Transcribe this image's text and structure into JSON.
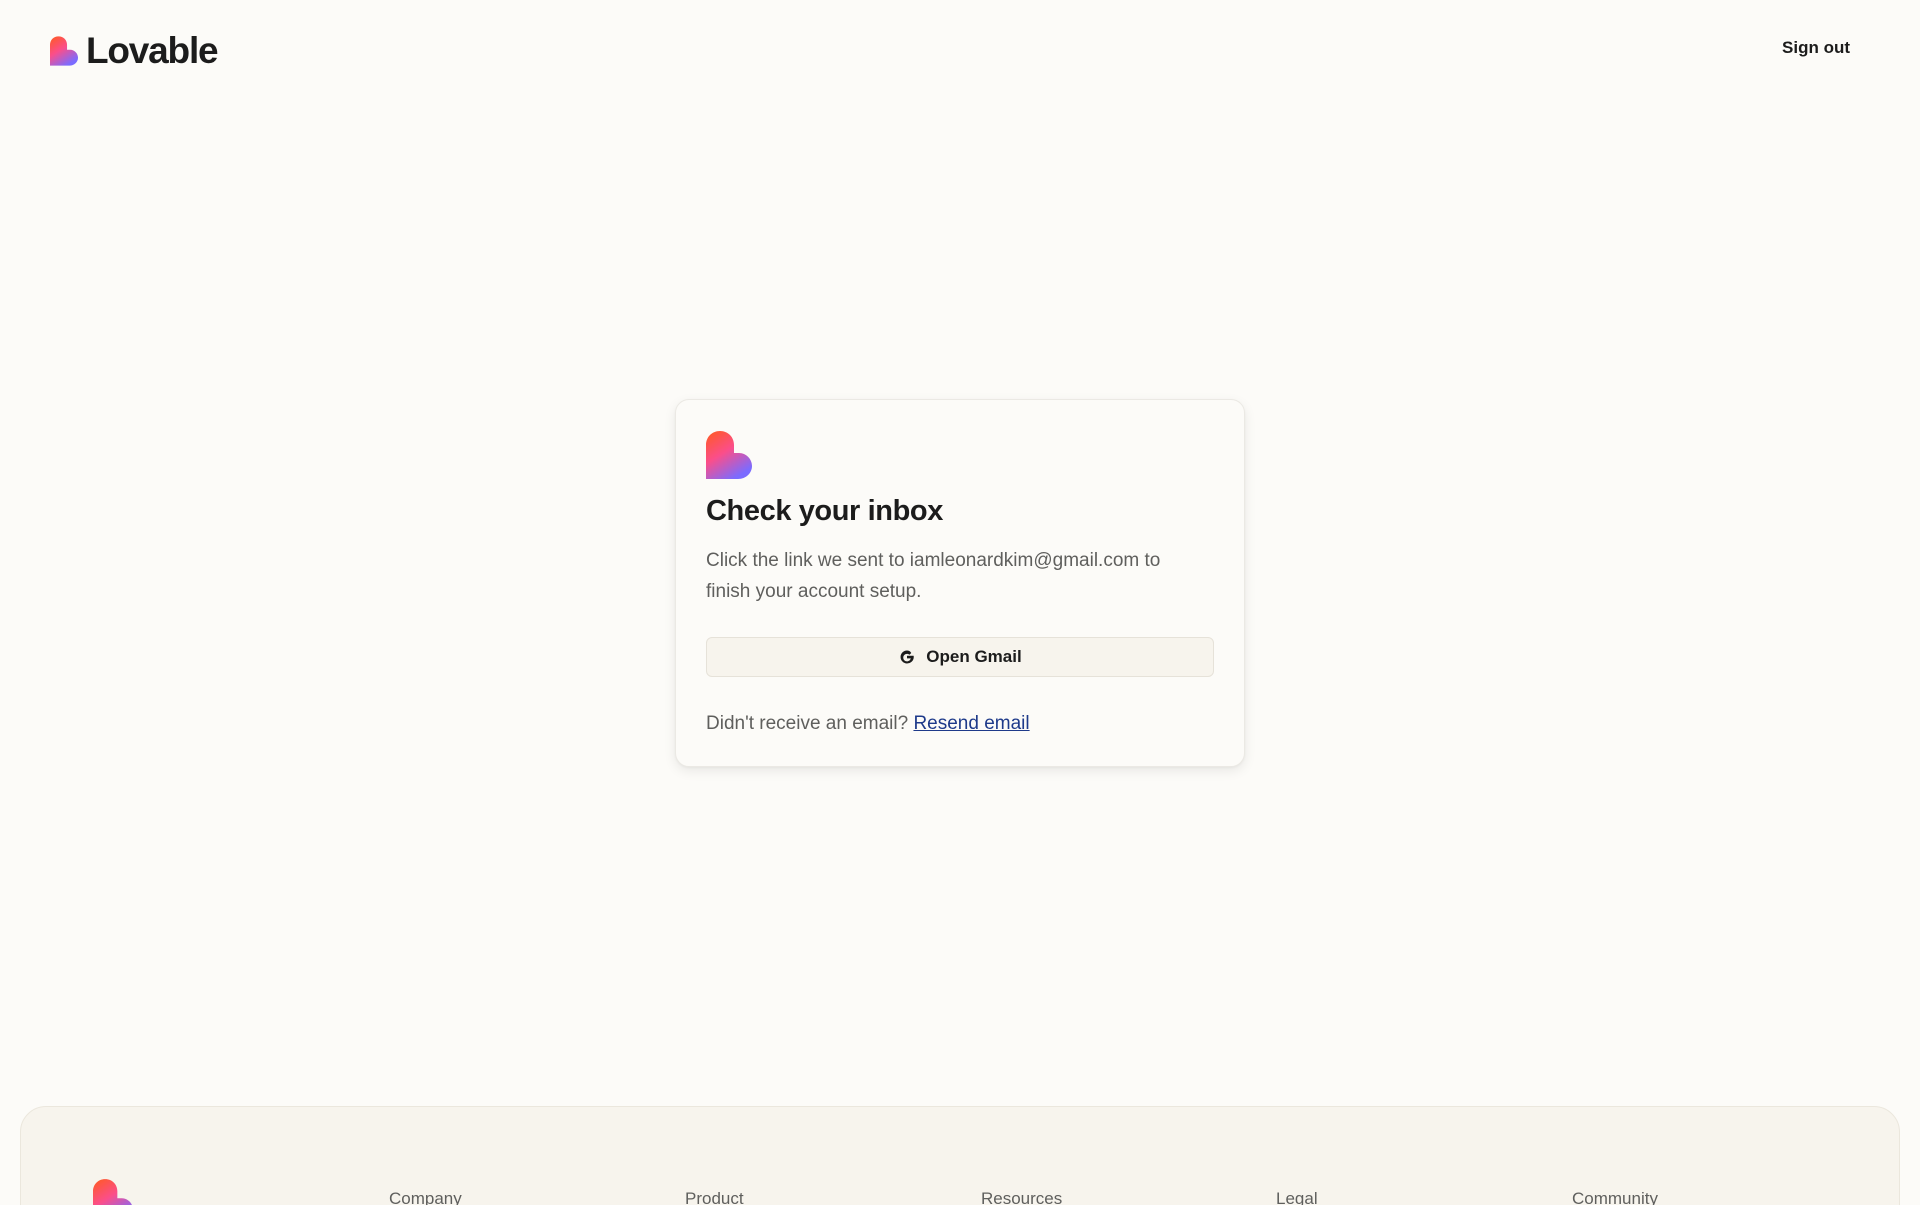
{
  "header": {
    "brand_name": "Lovable",
    "sign_out_label": "Sign out"
  },
  "card": {
    "title": "Check your inbox",
    "description": "Click the link we sent to iamleonardkim@gmail.com to finish your account setup.",
    "open_button_label": "Open Gmail",
    "resend_prompt": "Didn't receive an email?",
    "resend_link": "Resend email"
  },
  "footer": {
    "columns": [
      "Company",
      "Product",
      "Resources",
      "Legal",
      "Community"
    ]
  },
  "colors": {
    "background": "#fcfbf8",
    "footer_background": "#f7f4ed",
    "text_primary": "#1c1c1c",
    "text_secondary": "#5f5f5d",
    "link": "#1e3a8a"
  },
  "icons": {
    "brand": "lovable-heart-logo-icon",
    "open_button": "google-g-icon"
  }
}
